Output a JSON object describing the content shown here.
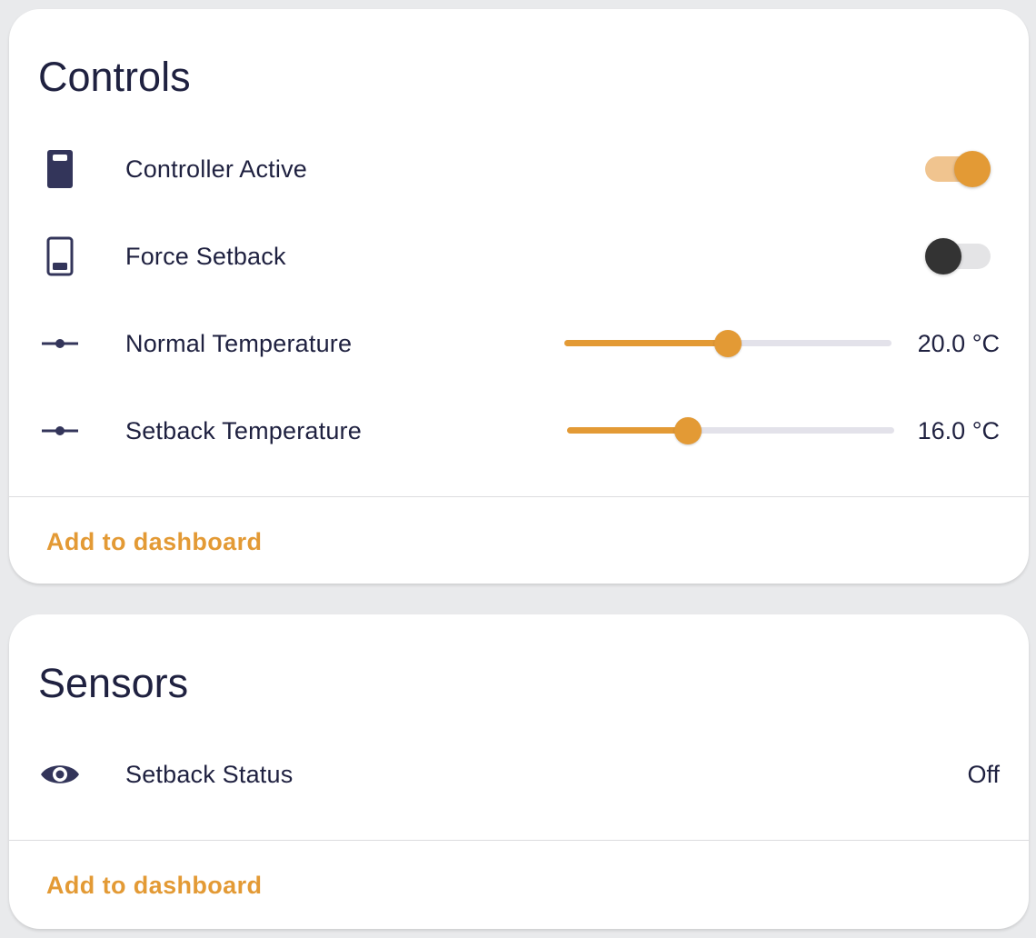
{
  "controls": {
    "title": "Controls",
    "rows": [
      {
        "label": "Controller Active",
        "icon": "switch-on-icon",
        "type": "toggle",
        "state": true
      },
      {
        "label": "Force Setback",
        "icon": "switch-off-icon",
        "type": "toggle",
        "state": false
      },
      {
        "label": "Normal Temperature",
        "icon": "slider-icon",
        "type": "slider",
        "value_text": "20.0 °C",
        "fill_fraction": 0.5
      },
      {
        "label": "Setback Temperature",
        "icon": "slider-icon",
        "type": "slider",
        "value_text": "16.0 °C",
        "fill_fraction": 0.37
      }
    ],
    "add_label": "Add to dashboard"
  },
  "sensors": {
    "title": "Sensors",
    "rows": [
      {
        "label": "Setback Status",
        "icon": "eye-icon",
        "value_text": "Off"
      }
    ],
    "add_label": "Add to dashboard"
  },
  "colors": {
    "accent": "#e39a35",
    "accent_light": "#f0c48f",
    "text": "#1f2140",
    "icon": "#33355a",
    "background": "#e9eaec",
    "card": "#ffffff"
  }
}
